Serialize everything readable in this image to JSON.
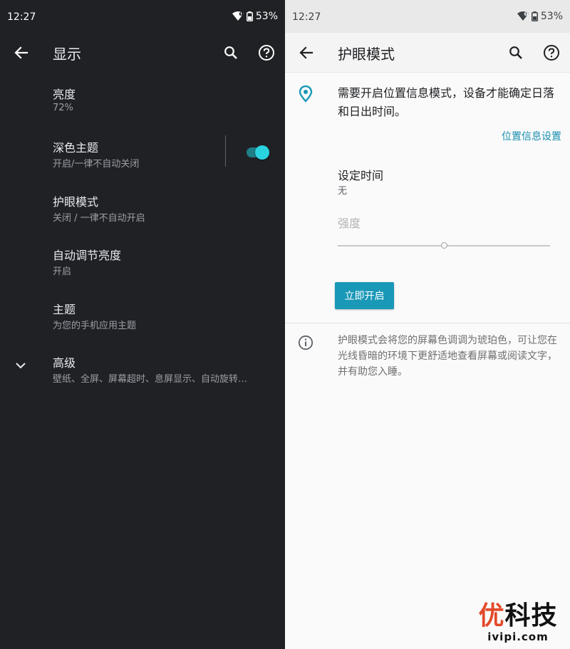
{
  "left": {
    "status": {
      "time": "12:27",
      "battery": "53%"
    },
    "appbar": {
      "title": "显示"
    },
    "prefs": [
      {
        "title": "亮度",
        "summary": "72%"
      },
      {
        "title": "深色主题",
        "summary": "开启/一律不自动关闭",
        "toggle_on": true
      },
      {
        "title": "护眼模式",
        "summary": "关闭 / 一律不自动开启"
      },
      {
        "title": "自动调节亮度",
        "summary": "开启"
      },
      {
        "title": "主题",
        "summary": "为您的手机应用主题"
      },
      {
        "title": "高级",
        "summary": "壁纸、全屏、屏幕超时、息屏显示、自动旋转…"
      }
    ],
    "colors": {
      "background": "#202125",
      "accent": "#2ad3e0"
    }
  },
  "right": {
    "status": {
      "time": "12:27",
      "battery": "53%"
    },
    "appbar": {
      "title": "护眼模式"
    },
    "location_message": "需要开启位置信息模式，设备才能确定日落和日出时间。",
    "location_link": "位置信息设置",
    "schedule": {
      "title": "设定时间",
      "value": "无"
    },
    "intensity": {
      "label": "强度",
      "value": 0.5,
      "enabled": false
    },
    "primary_button": "立即开启",
    "info_text": "护眼模式会将您的屏幕色调调为琥珀色，可让您在光线昏暗的环境下更舒适地查看屏幕或阅读文字，并有助您入睡。",
    "colors": {
      "background": "#fafafa",
      "accent": "#1a98b7"
    }
  },
  "watermark": {
    "logo": "优科技",
    "url": "ivipi.com"
  }
}
